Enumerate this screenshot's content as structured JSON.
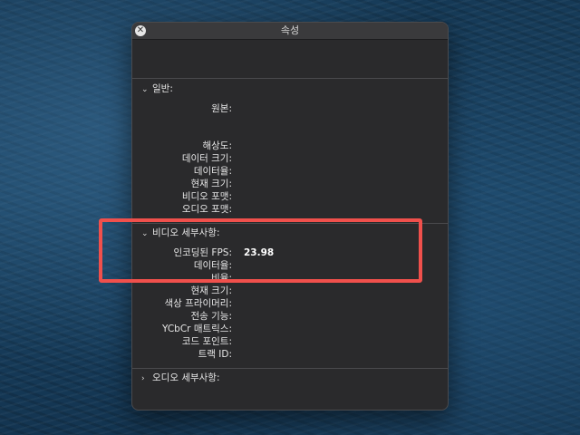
{
  "window": {
    "title": "속성"
  },
  "sections": {
    "general": {
      "title": "일반:",
      "rows": [
        {
          "label": "원본:",
          "value": ""
        },
        {
          "label": "해상도:",
          "value": ""
        },
        {
          "label": "데이터 크기:",
          "value": ""
        },
        {
          "label": "데이터율:",
          "value": ""
        },
        {
          "label": "현재 크기:",
          "value": ""
        },
        {
          "label": "비디오 포맷:",
          "value": ""
        },
        {
          "label": "오디오 포맷:",
          "value": ""
        }
      ]
    },
    "video": {
      "title": "비디오 세부사항:",
      "rows": [
        {
          "label": "인코딩된 FPS:",
          "value": "23.98"
        },
        {
          "label": "데이터율:",
          "value": ""
        },
        {
          "label": "비율:",
          "value": ""
        },
        {
          "label": "현재 크기:",
          "value": ""
        },
        {
          "label": "색상 프라이머리:",
          "value": ""
        },
        {
          "label": "전송 기능:",
          "value": ""
        },
        {
          "label": "YCbCr 매트릭스:",
          "value": ""
        },
        {
          "label": "코드 포인트:",
          "value": ""
        },
        {
          "label": "트랙 ID:",
          "value": ""
        }
      ]
    },
    "audio": {
      "title": "오디오 세부사항:"
    }
  },
  "colors": {
    "highlight": "#f0504c",
    "panel": "#2a2a2c"
  }
}
